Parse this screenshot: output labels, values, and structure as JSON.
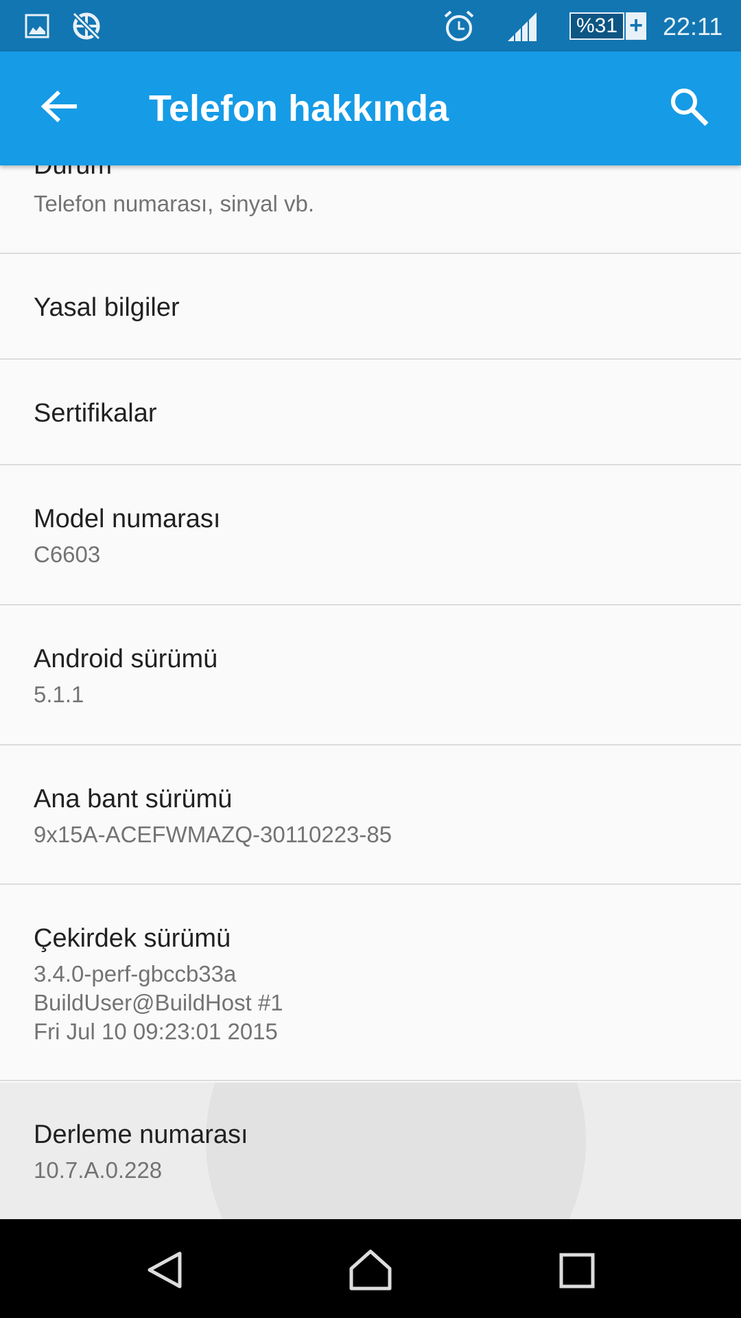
{
  "status_bar": {
    "time": "22:11",
    "battery": "%31",
    "icons": [
      "gallery-icon",
      "no-data-globe-icon",
      "alarm-icon",
      "signal-icon",
      "battery-charging-icon"
    ]
  },
  "app_bar": {
    "title": "Telefon hakkında",
    "back_icon": "arrow-left-icon",
    "search_icon": "search-icon"
  },
  "colors": {
    "status_bar": "#1276b2",
    "app_bar": "#169be6",
    "pressed_row": "#ececec"
  },
  "items": [
    {
      "title": "Durum",
      "subtitle": "Telefon numarası, sinyal vb."
    },
    {
      "title": "Yasal bilgiler"
    },
    {
      "title": "Sertifikalar"
    },
    {
      "title": "Model numarası",
      "subtitle": "C6603"
    },
    {
      "title": "Android sürümü",
      "subtitle": "5.1.1"
    },
    {
      "title": "Ana bant sürümü",
      "subtitle": "9x15A-ACEFWMAZQ-30110223-85"
    },
    {
      "title": "Çekirdek sürümü",
      "subtitle_lines": [
        "3.4.0-perf-gbccb33a",
        "BuildUser@BuildHost #1",
        "Fri Jul 10 09:23:01 2015"
      ]
    },
    {
      "title": "Derleme numarası",
      "subtitle": "10.7.A.0.228"
    }
  ],
  "nav_bar": {
    "icons": [
      "back-triangle-icon",
      "home-icon",
      "recents-icon"
    ]
  }
}
